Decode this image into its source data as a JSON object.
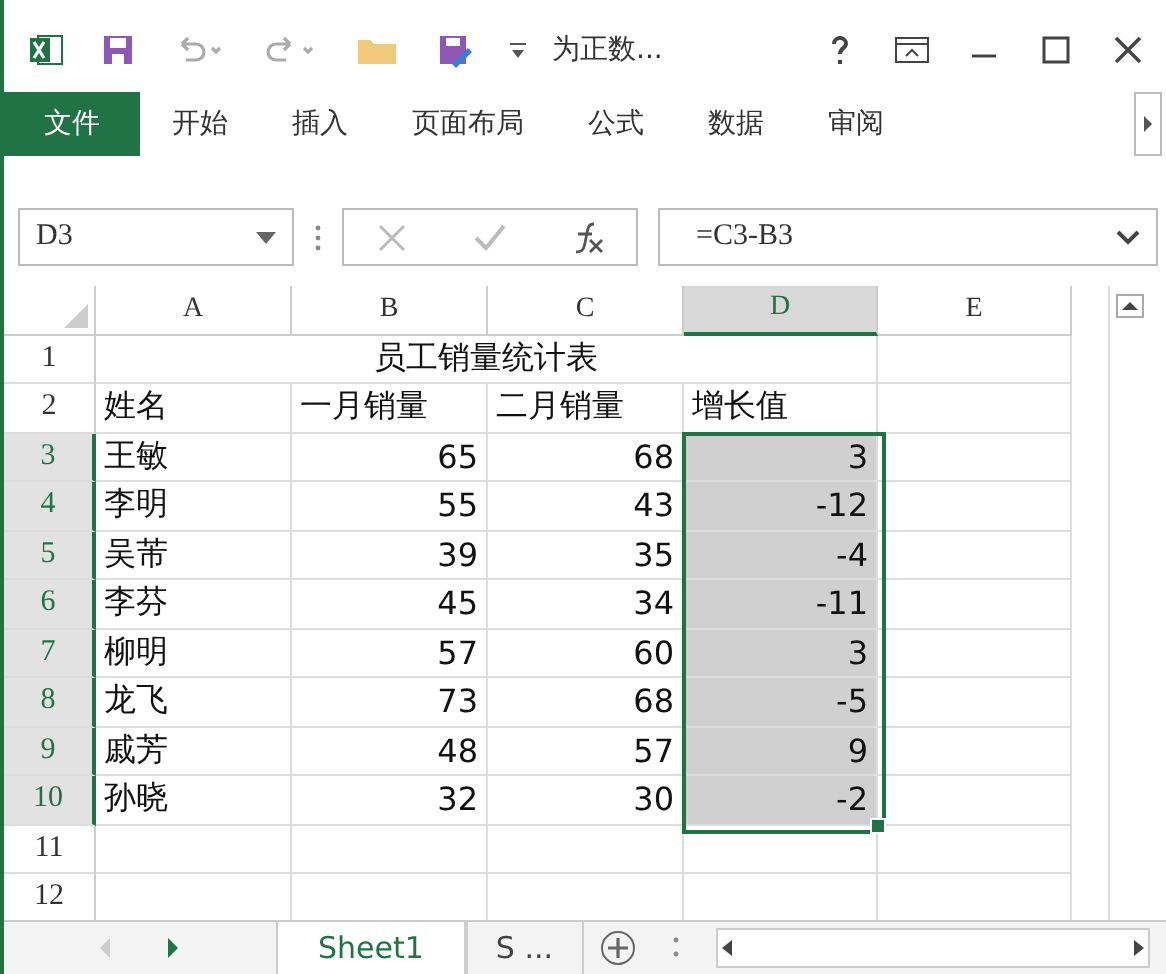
{
  "window": {
    "title": "为正数..."
  },
  "ribbon_tabs": [
    {
      "label": "文件",
      "selected": true
    },
    {
      "label": "开始",
      "selected": false
    },
    {
      "label": "插入",
      "selected": false
    },
    {
      "label": "页面布局",
      "selected": false
    },
    {
      "label": "公式",
      "selected": false
    },
    {
      "label": "数据",
      "selected": false
    },
    {
      "label": "审阅",
      "selected": false
    }
  ],
  "formula_bar": {
    "name_box": "D3",
    "formula": "=C3-B3"
  },
  "columns": [
    {
      "label": "A",
      "selected": false
    },
    {
      "label": "B",
      "selected": false
    },
    {
      "label": "C",
      "selected": false
    },
    {
      "label": "D",
      "selected": true
    },
    {
      "label": "E",
      "selected": false
    }
  ],
  "rows": [
    {
      "number": "1",
      "selected": false,
      "title": "员工销量统计表"
    },
    {
      "number": "2",
      "selected": false,
      "cells": [
        "姓名",
        "一月销量",
        "二月销量",
        "增长值",
        ""
      ]
    },
    {
      "number": "3",
      "selected": true,
      "cells": [
        "王敏",
        "65",
        "68",
        "3",
        ""
      ]
    },
    {
      "number": "4",
      "selected": true,
      "cells": [
        "李明",
        "55",
        "43",
        "-12",
        ""
      ]
    },
    {
      "number": "5",
      "selected": true,
      "cells": [
        "吴芾",
        "39",
        "35",
        "-4",
        ""
      ]
    },
    {
      "number": "6",
      "selected": true,
      "cells": [
        "李芬",
        "45",
        "34",
        "-11",
        ""
      ]
    },
    {
      "number": "7",
      "selected": true,
      "cells": [
        "柳明",
        "57",
        "60",
        "3",
        ""
      ]
    },
    {
      "number": "8",
      "selected": true,
      "cells": [
        "龙飞",
        "73",
        "68",
        "-5",
        ""
      ]
    },
    {
      "number": "9",
      "selected": true,
      "cells": [
        "戚芳",
        "48",
        "57",
        "9",
        ""
      ]
    },
    {
      "number": "10",
      "selected": true,
      "cells": [
        "孙晓",
        "32",
        "30",
        "-2",
        ""
      ]
    },
    {
      "number": "11",
      "selected": false,
      "cells": [
        "",
        "",
        "",
        "",
        ""
      ]
    },
    {
      "number": "12",
      "selected": false,
      "cells": [
        "",
        "",
        "",
        "",
        ""
      ]
    }
  ],
  "sheet_tabs": [
    {
      "label": "Sheet1",
      "selected": true
    },
    {
      "label": "S ...",
      "selected": false
    }
  ]
}
